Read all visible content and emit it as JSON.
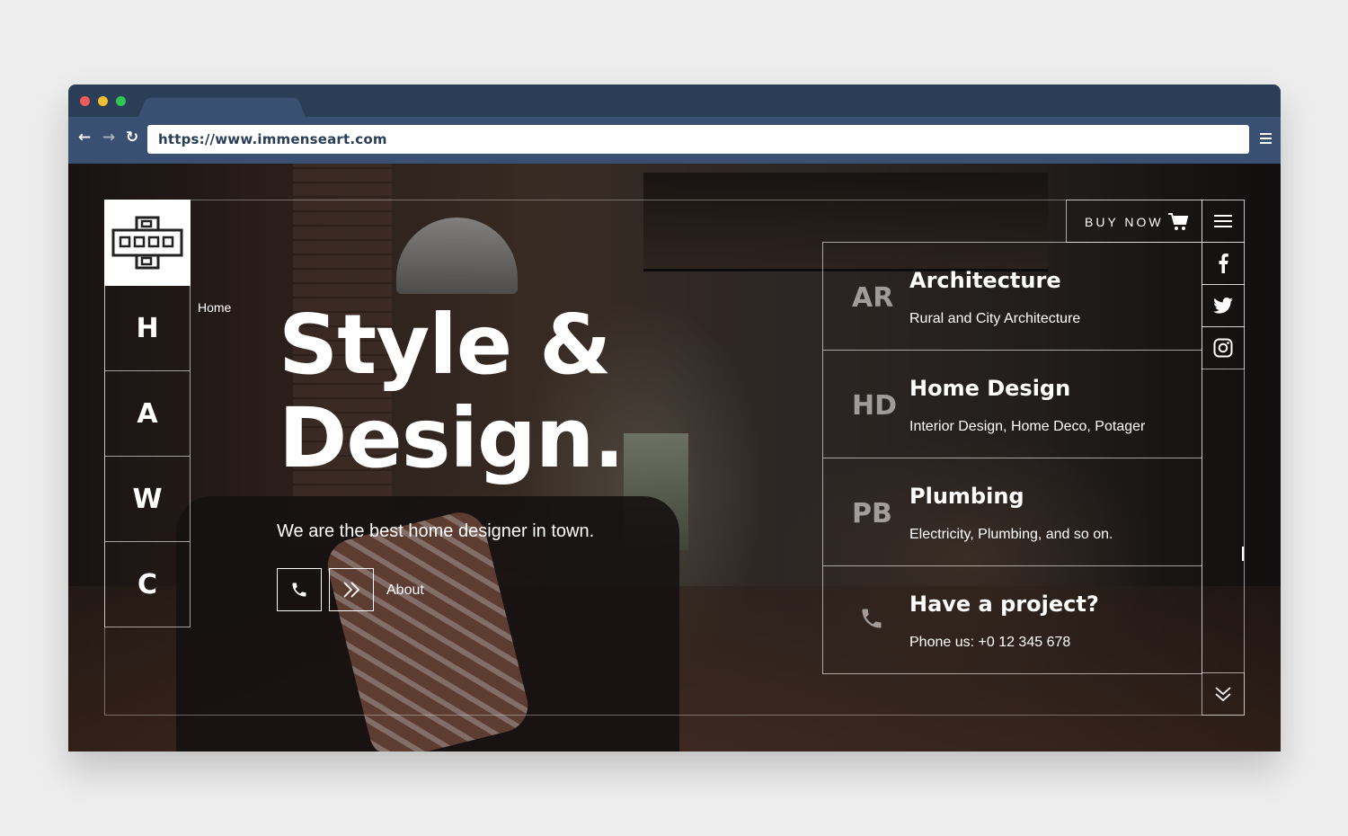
{
  "browser": {
    "url": "https://www.immenseart.com"
  },
  "sidebar": {
    "items": [
      {
        "label": "H"
      },
      {
        "label": "A"
      },
      {
        "label": "W"
      },
      {
        "label": "C"
      }
    ]
  },
  "breadcrumb": "Home",
  "hero": {
    "title_line1": "Style &",
    "title_line2": "Design.",
    "subtitle": "We are the best home designer in town.",
    "about_label": "About"
  },
  "header": {
    "buy_now_label": "BUY NOW"
  },
  "services": [
    {
      "abbr": "AR",
      "title": "Architecture",
      "desc": "Rural and City Architecture"
    },
    {
      "abbr": "HD",
      "title": "Home Design",
      "desc": "Interior Design, Home Deco, Potager"
    },
    {
      "abbr": "PB",
      "title": "Plumbing",
      "desc": "Electricity, Plumbing, and so on."
    },
    {
      "icon": "phone-icon",
      "title": "Have a project?",
      "desc": "Phone us: +0 12 345 678"
    }
  ],
  "colors": {
    "browser_chrome": "#2b3e57",
    "toolbar": "#3a5072",
    "page_bg": "#ededed"
  }
}
